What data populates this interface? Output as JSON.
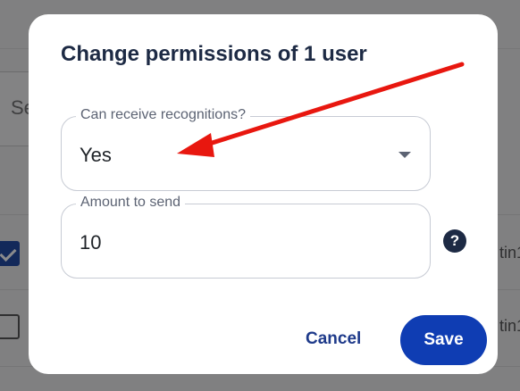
{
  "background": {
    "search_text": "Se",
    "rows": [
      {
        "text": "tin1",
        "checked": true
      },
      {
        "text": "tin1",
        "checked": false
      }
    ]
  },
  "dialog": {
    "title": "Change permissions of 1 user",
    "recognitions_field": {
      "label": "Can receive recognitions?",
      "value": "Yes"
    },
    "amount_field": {
      "label": "Amount to send",
      "value": "10"
    },
    "help_icon": "?",
    "cancel_label": "Cancel",
    "save_label": "Save"
  },
  "colors": {
    "accent": "#0f3db3",
    "title": "#1d2a44",
    "arrow": "#e8170f"
  }
}
